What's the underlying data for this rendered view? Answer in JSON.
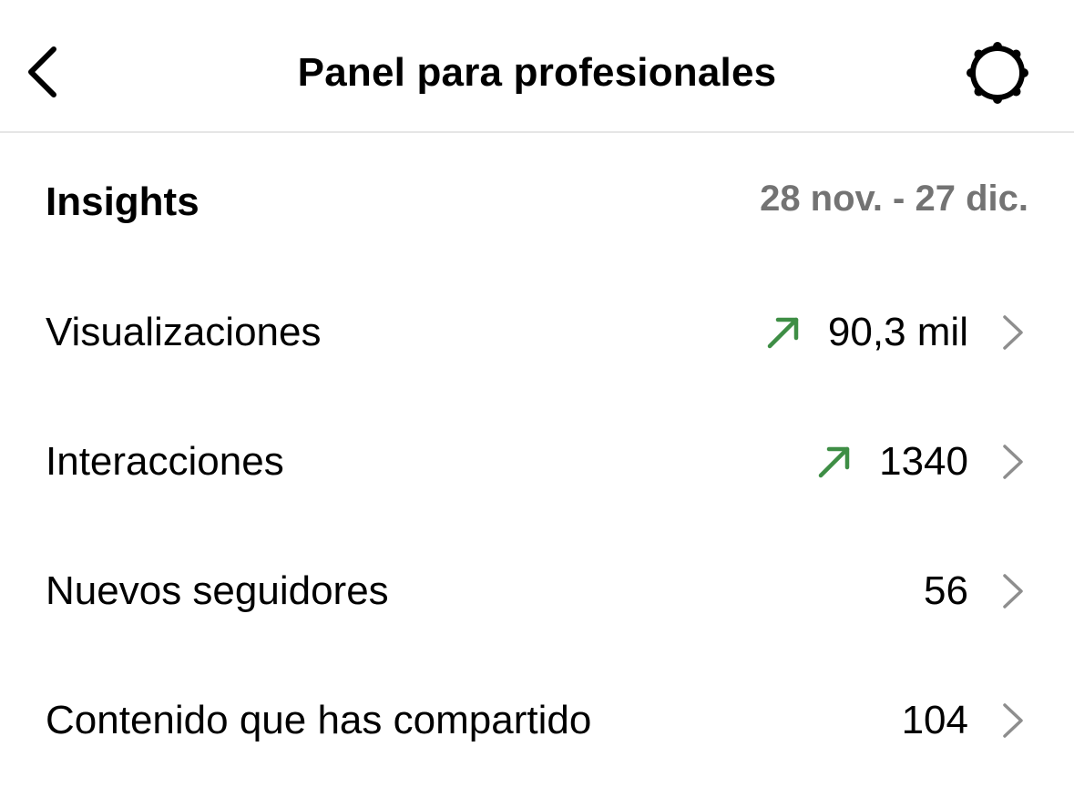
{
  "header": {
    "title": "Panel para profesionales",
    "back_icon": "chevron-left-icon",
    "settings_icon": "gear-icon"
  },
  "insights": {
    "title": "Insights",
    "date_range": "28 nov. - 27 dic."
  },
  "metrics": [
    {
      "label": "Visualizaciones",
      "value": "90,3 mil",
      "trend": "up"
    },
    {
      "label": "Interacciones",
      "value": "1340",
      "trend": "up"
    },
    {
      "label": "Nuevos seguidores",
      "value": "56",
      "trend": "none"
    },
    {
      "label": "Contenido que has compartido",
      "value": "104",
      "trend": "none"
    }
  ],
  "colors": {
    "trend_up": "#3e8e45",
    "muted_text": "#737373",
    "chevron": "#8e8e8e",
    "divider": "#e6e6e6"
  }
}
